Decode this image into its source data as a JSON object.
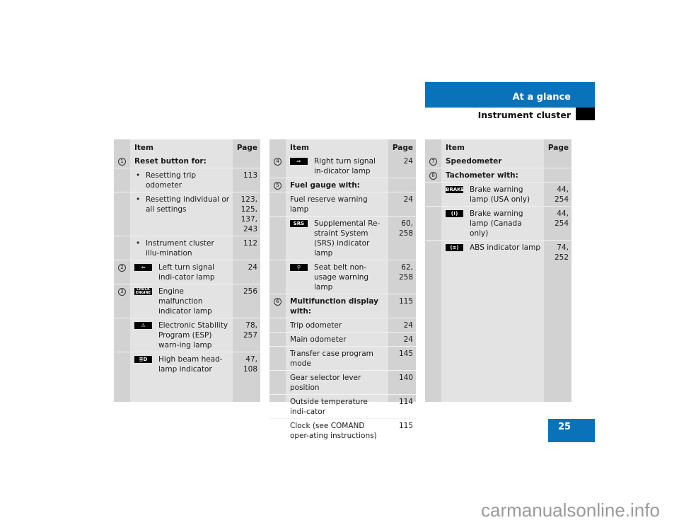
{
  "header": {
    "section": "At a glance",
    "subtitle": "Instrument cluster",
    "accent_color": "#0a72b8"
  },
  "page_number": "25",
  "watermark": "carmanualsonline.info",
  "tables": [
    {
      "headers": {
        "item": "Item",
        "page": "Page"
      },
      "rows": [
        {
          "num": "1",
          "text": "Reset button for:",
          "page": "",
          "type": "bold"
        },
        {
          "text": "Resetting trip odometer",
          "page": "113",
          "type": "bullet"
        },
        {
          "text": "Resetting individual or all settings",
          "page": "123, 125, 137, 243",
          "type": "bullet"
        },
        {
          "text": "Instrument cluster illu-mination",
          "page": "112",
          "type": "bullet"
        },
        {
          "num": "2",
          "icon": "left-turn-signal-icon",
          "icon_label": "⇦",
          "text": "Left turn signal indi-cator lamp",
          "page": "24",
          "type": "icon"
        },
        {
          "num": "3",
          "icon": "check-engine-icon",
          "icon_label": "CHECK ENGINE",
          "text": "Engine malfunction indicator lamp",
          "page": "256",
          "type": "icon"
        },
        {
          "icon": "esp-warning-icon",
          "icon_label": "⚠",
          "text": "Electronic Stability Program (ESP) warn-ing lamp",
          "page": "78, 257",
          "type": "icon"
        },
        {
          "icon": "high-beam-icon",
          "icon_label": "≣D",
          "text": "High beam head-lamp indicator",
          "page": "47, 108",
          "type": "icon"
        }
      ]
    },
    {
      "headers": {
        "item": "Item",
        "page": "Page"
      },
      "rows": [
        {
          "num": "4",
          "icon": "right-turn-signal-icon",
          "icon_label": "⇨",
          "text": "Right turn signal in-dicator lamp",
          "page": "24",
          "type": "icon"
        },
        {
          "num": "5",
          "text": "Fuel gauge with:",
          "page": "",
          "type": "bold"
        },
        {
          "text": "Fuel reserve warning lamp",
          "page": "24",
          "type": "plain"
        },
        {
          "icon": "srs-icon",
          "icon_label": "SRS",
          "text": "Supplemental Re-straint System (SRS) indicator lamp",
          "page": "60, 258",
          "type": "icon"
        },
        {
          "icon": "seat-belt-icon",
          "icon_label": "⚲",
          "text": "Seat belt non-usage warning lamp",
          "page": "62, 258",
          "type": "icon"
        },
        {
          "num": "6",
          "text": "Multifunction display with:",
          "page": "115",
          "type": "bold"
        },
        {
          "text": "Trip odometer",
          "page": "24",
          "type": "plain"
        },
        {
          "text": "Main odometer",
          "page": "24",
          "type": "plain"
        },
        {
          "text": "Transfer case program mode",
          "page": "145",
          "type": "plain"
        },
        {
          "text": "Gear selector lever position",
          "page": "140",
          "type": "plain"
        },
        {
          "text": "Outside temperature indi-cator",
          "page": "114",
          "type": "plain"
        },
        {
          "text": "Clock (see COMAND oper-ating instructions)",
          "page": "115",
          "type": "plain"
        }
      ]
    },
    {
      "headers": {
        "item": "Item",
        "page": "Page"
      },
      "rows": [
        {
          "num": "7",
          "text": "Speedometer",
          "page": "",
          "type": "bold"
        },
        {
          "num": "8",
          "text": "Tachometer with:",
          "page": "",
          "type": "bold"
        },
        {
          "icon": "brake-warning-usa-icon",
          "icon_label": "BRAKE",
          "text": "Brake warning lamp (USA only)",
          "page": "44, 254",
          "type": "icon"
        },
        {
          "icon": "brake-warning-canada-icon",
          "icon_label": "(!)",
          "text": "Brake warning lamp (Canada only)",
          "page": "44, 254",
          "type": "icon"
        },
        {
          "icon": "abs-indicator-icon",
          "icon_label": "(≡)",
          "text": "ABS indicator lamp",
          "page": "74, 252",
          "type": "icon"
        }
      ]
    }
  ]
}
